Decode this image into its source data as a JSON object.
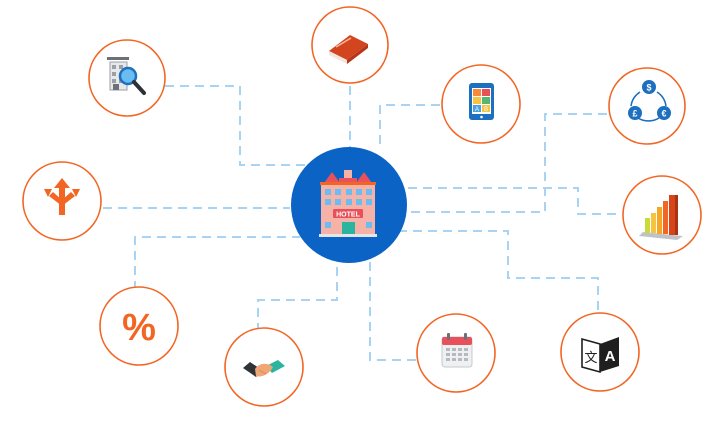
{
  "colors": {
    "ring": "#f26522",
    "hub": "#0b63c5",
    "connector": "#a9d3f2",
    "background": "#ffffff"
  },
  "hub": {
    "icon": "hotel-building-icon",
    "sign_text": "HOTEL"
  },
  "nodes": [
    {
      "icon": "book-icon"
    },
    {
      "icon": "building-search-icon"
    },
    {
      "icon": "tablet-app-icon",
      "tiles": [
        "A",
        "B"
      ]
    },
    {
      "icon": "currency-exchange-icon",
      "symbols": [
        "$",
        "£",
        "€"
      ]
    },
    {
      "icon": "split-arrows-icon"
    },
    {
      "icon": "bar-chart-icon"
    },
    {
      "icon": "percent-icon",
      "symbol": "%"
    },
    {
      "icon": "handshake-icon"
    },
    {
      "icon": "calendar-icon"
    },
    {
      "icon": "translate-icon",
      "glyphs": [
        "文",
        "A"
      ]
    }
  ]
}
